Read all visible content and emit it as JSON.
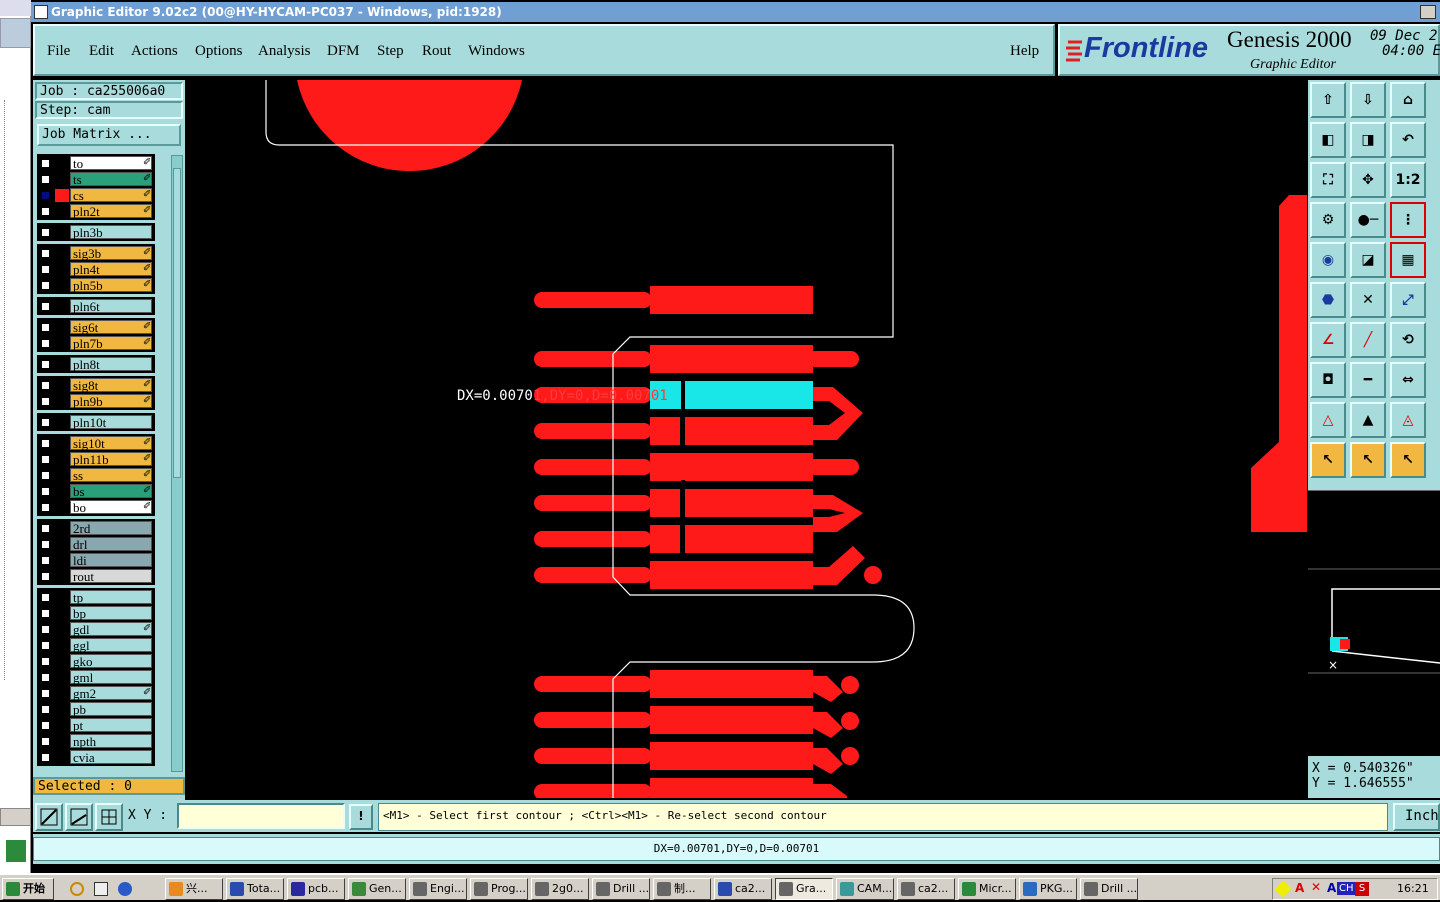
{
  "window": {
    "title": "Graphic Editor 9.02c2 (00@HY-HYCAM-PC037 - Windows, pid:1928)"
  },
  "menu": {
    "items": [
      "File",
      "Edit",
      "Actions",
      "Options",
      "Analysis",
      "DFM",
      "Step",
      "Rout",
      "Windows"
    ],
    "help": "Help"
  },
  "brand": {
    "logo": "Frontline",
    "product": "Genesis 2000",
    "subtitle": "Graphic Editor",
    "date": "09 Dec 2",
    "time": "04:00 E"
  },
  "job": {
    "job_label": "Job : ca255006a0",
    "step_label": "Step: cam",
    "matrix_button": "Job Matrix ..."
  },
  "layers": [
    {
      "name": "to",
      "color": "#ffffff",
      "flag": true
    },
    {
      "name": "ts",
      "color": "#2aa07a",
      "flag": true
    },
    {
      "name": "cs",
      "color": "#f0b840",
      "flag": true,
      "active": true
    },
    {
      "name": "pln2t",
      "color": "#f0b840",
      "flag": true
    },
    {
      "name": "pln3b",
      "color": "#a8dcdc",
      "flag": false
    },
    {
      "name": "sig3b",
      "color": "#f0b840",
      "flag": true
    },
    {
      "name": "pln4t",
      "color": "#f0b840",
      "flag": true
    },
    {
      "name": "pln5b",
      "color": "#f0b840",
      "flag": true
    },
    {
      "name": "pln6t",
      "color": "#a8dcdc",
      "flag": false
    },
    {
      "name": "sig6t",
      "color": "#f0b840",
      "flag": true
    },
    {
      "name": "pln7b",
      "color": "#f0b840",
      "flag": true
    },
    {
      "name": "pln8t",
      "color": "#a8dcdc",
      "flag": false
    },
    {
      "name": "sig8t",
      "color": "#f0b840",
      "flag": true
    },
    {
      "name": "pln9b",
      "color": "#f0b840",
      "flag": true
    },
    {
      "name": "pln10t",
      "color": "#a8dcdc",
      "flag": false
    },
    {
      "name": "sig10t",
      "color": "#f0b840",
      "flag": true
    },
    {
      "name": "pln11b",
      "color": "#f0b840",
      "flag": true
    },
    {
      "name": "ss",
      "color": "#f0b840",
      "flag": true
    },
    {
      "name": "bs",
      "color": "#2aa07a",
      "flag": true
    },
    {
      "name": "bo",
      "color": "#ffffff",
      "flag": true
    },
    {
      "name": "2rd",
      "color": "#8aa8b0",
      "flag": false
    },
    {
      "name": "drl",
      "color": "#8aa8b0",
      "flag": false
    },
    {
      "name": "ldi",
      "color": "#8aa8b0",
      "flag": false
    },
    {
      "name": "rout",
      "color": "#d8d8d8",
      "flag": false
    },
    {
      "name": "tp",
      "color": "#a8dcdc",
      "flag": false
    },
    {
      "name": "bp",
      "color": "#a8dcdc",
      "flag": false
    },
    {
      "name": "gdl",
      "color": "#a8dcdc",
      "flag": true
    },
    {
      "name": "ggl",
      "color": "#a8dcdc",
      "flag": false
    },
    {
      "name": "gko",
      "color": "#a8dcdc",
      "flag": false
    },
    {
      "name": "gml",
      "color": "#a8dcdc",
      "flag": false
    },
    {
      "name": "gm2",
      "color": "#a8dcdc",
      "flag": true
    },
    {
      "name": "pb",
      "color": "#a8dcdc",
      "flag": false
    },
    {
      "name": "pt",
      "color": "#a8dcdc",
      "flag": false
    },
    {
      "name": "npth",
      "color": "#a8dcdc",
      "flag": false
    },
    {
      "name": "cvia",
      "color": "#a8dcdc",
      "flag": false
    }
  ],
  "selected": "Selected : 0",
  "measure_overlay": {
    "dx": "DX=0.0070",
    "rest": "1,DY=0,D=0.00701"
  },
  "coords": {
    "x": "X = 0.540326\"",
    "y": "Y = 1.646555\""
  },
  "status": {
    "xy_label": "X Y :",
    "prompt": "<M1> - Select first contour ; <Ctrl><M1> - Re-select second contour",
    "units": "Inch"
  },
  "message": "DX=0.00701,DY=0,D=0.00701",
  "toolbar_icons": [
    "home-up-icon",
    "home-down-icon",
    "home-icon",
    "prev-icon",
    "next-icon",
    "undo-icon",
    "zoom-fit-icon",
    "zoom-center-icon",
    "ratio-icon",
    "tools-icon",
    "pad-icon",
    "layers-icon",
    "select-icon",
    "shape-icon",
    "ruler-icon",
    "net-icon",
    "delete-icon",
    "snap-icon",
    "line-icon",
    "line-red-icon",
    "arc-icon",
    "pad-add-icon",
    "bar-icon",
    "measure-icon",
    "triangle-icon",
    "triangle-up-icon",
    "triangle-outline-icon",
    "pointer-icon",
    "pointer-box-icon",
    "pointer-circle-icon"
  ],
  "taskbar": {
    "start": "开始",
    "tasks": [
      "兴...",
      "Tota...",
      "pcb...",
      "Gen...",
      "Engi...",
      "Prog...",
      "2g0...",
      "Drill ...",
      "制...",
      "ca2...",
      "Gra...",
      "CAM...",
      "ca2...",
      "Micr...",
      "PKG...",
      "Drill ..."
    ],
    "clock": "16:21",
    "tray_lang": "CH"
  }
}
